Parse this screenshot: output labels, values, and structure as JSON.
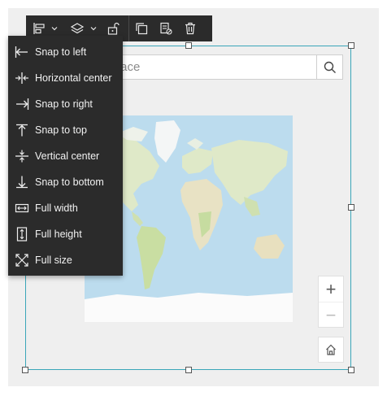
{
  "toolbar": {
    "items": [
      {
        "icon": "align-left-icon"
      },
      {
        "icon": "chevron-down-icon"
      },
      {
        "icon": "layers-icon"
      },
      {
        "icon": "chevron-down-icon"
      },
      {
        "icon": "unlock-icon"
      },
      {
        "icon": "duplicate-icon"
      },
      {
        "icon": "copy-style-icon"
      },
      {
        "icon": "trash-icon"
      }
    ]
  },
  "menu": {
    "items": [
      {
        "label": "Snap to left",
        "icon": "snap-left-icon"
      },
      {
        "label": "Horizontal center",
        "icon": "horizontal-center-icon"
      },
      {
        "label": "Snap to right",
        "icon": "snap-right-icon"
      },
      {
        "label": "Snap to top",
        "icon": "snap-top-icon"
      },
      {
        "label": "Vertical center",
        "icon": "vertical-center-icon"
      },
      {
        "label": "Snap to bottom",
        "icon": "snap-bottom-icon"
      },
      {
        "label": "Full width",
        "icon": "full-width-icon"
      },
      {
        "label": "Full height",
        "icon": "full-height-icon"
      },
      {
        "label": "Full size",
        "icon": "full-size-icon"
      }
    ]
  },
  "search": {
    "placeholder_visible": "or place",
    "button_icon": "search-icon"
  },
  "map_controls": {
    "zoom_in": "+",
    "zoom_out": "−",
    "home_icon": "home-icon"
  },
  "colors": {
    "selection": "#3aa6b9",
    "ocean": "#bcdcee",
    "land": "#dfe9c8",
    "menu_bg": "#2b2b2b"
  }
}
